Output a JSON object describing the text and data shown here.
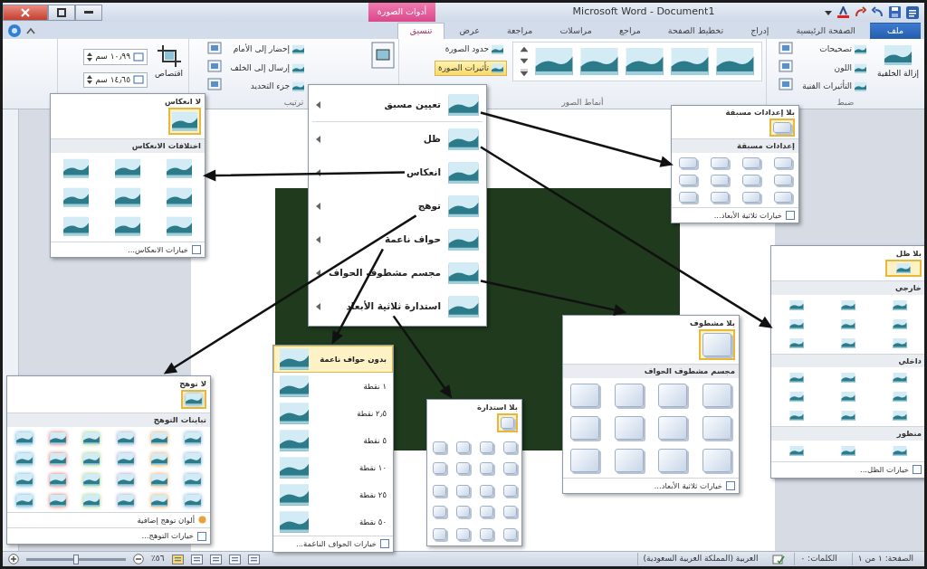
{
  "window": {
    "title": "Microsoft Word - Document1",
    "contextual_tab": "أدوات الصورة"
  },
  "tabs": [
    {
      "label": "ملف",
      "kind": "file",
      "selected": false
    },
    {
      "label": "الصفحة الرئيسية",
      "kind": "tab",
      "selected": false
    },
    {
      "label": "إدراج",
      "kind": "tab",
      "selected": false
    },
    {
      "label": "تخطيط الصفحة",
      "kind": "tab",
      "selected": false
    },
    {
      "label": "مراجع",
      "kind": "tab",
      "selected": false
    },
    {
      "label": "مراسلات",
      "kind": "tab",
      "selected": false
    },
    {
      "label": "مراجعة",
      "kind": "tab",
      "selected": false
    },
    {
      "label": "عرض",
      "kind": "tab",
      "selected": false
    },
    {
      "label": "تنسيق",
      "kind": "contextual",
      "selected": true
    }
  ],
  "ribbon": {
    "groups": [
      {
        "kind": "adjust",
        "label": "ضبط",
        "big_button": "إزالة الخلفية",
        "items": [
          {
            "label": "تصحيحات",
            "selected": false
          },
          {
            "label": "اللون",
            "selected": false
          },
          {
            "label": "التأثيرات الفنية",
            "selected": false
          }
        ]
      },
      {
        "kind": "styles",
        "label": "أنماط الصور",
        "items": [
          {
            "label": "حدود الصورة",
            "selected": false
          },
          {
            "label": "تأثيرات الصورة",
            "selected": true
          }
        ]
      },
      {
        "kind": "arrange",
        "label": "ترتيب",
        "items": [
          {
            "label": "إحضار إلى الأمام",
            "selected": false
          },
          {
            "label": "إرسال إلى الخلف",
            "selected": false
          },
          {
            "label": "جزء التحديد",
            "selected": false
          }
        ]
      },
      {
        "kind": "size",
        "big_button": "اقتصاص",
        "fields": [
          "١٠٫٩٩ سم",
          "١٤٫٦٥ سم"
        ]
      }
    ]
  },
  "effects_menu": [
    {
      "label": "تعيين مسبق"
    },
    {
      "label": "ظل"
    },
    {
      "label": "انعكاس"
    },
    {
      "label": "توهج"
    },
    {
      "label": "حواف ناعمة"
    },
    {
      "label": "مجسم مشطوف الحواف"
    },
    {
      "label": "استدارة ثلاثية الأبعاد"
    }
  ],
  "galleries": [
    {
      "kind": "preset",
      "none": {
        "label": "بلا إعدادات مسبقة",
        "selected": true
      },
      "sections": [
        "إعدادات مسبقة"
      ],
      "footer": "خيارات ثلاثية الأبعاد..."
    },
    {
      "kind": "shadow",
      "none": {
        "label": "بلا ظل",
        "selected": true
      },
      "sections": [
        "خارجي",
        "داخلي",
        "منظور"
      ],
      "footer": "خيارات الظل..."
    },
    {
      "kind": "reflection",
      "none": {
        "label": "لا انعكاس",
        "selected": true
      },
      "sections": [
        "اختلافات الانعكاس"
      ],
      "footer": "خيارات الانعكاس..."
    },
    {
      "kind": "glow",
      "none": {
        "label": "لا توهج",
        "selected": true
      },
      "sections": [
        "تباينات التوهج"
      ],
      "extra": "ألوان توهج إضافية",
      "footer": "خيارات التوهج..."
    },
    {
      "kind": "soft",
      "options": [
        {
          "label": "بدون حواف ناعمة",
          "selected": true
        },
        {
          "label": "١ نقطة",
          "selected": false
        },
        {
          "label": "٢٫٥ نقطة",
          "selected": false
        },
        {
          "label": "٥ نقطة",
          "selected": false
        },
        {
          "label": "١٠ نقطة",
          "selected": false
        },
        {
          "label": "٢٥ نقطة",
          "selected": false
        },
        {
          "label": "٥٠ نقطة",
          "selected": false
        }
      ],
      "footer": "خيارات الحواف الناعمة..."
    },
    {
      "kind": "bevel",
      "none": {
        "label": "بلا مشطوف",
        "selected": true
      },
      "sections": [
        "مجسم مشطوف الحواف"
      ],
      "footer": "خيارات ثلاثية الأبعاد..."
    },
    {
      "kind": "rotation",
      "none": {
        "label": "بلا استدارة",
        "selected": true
      }
    }
  ],
  "status_bar": {
    "page": "الصفحة: ١ من ١",
    "words": "الكلمات: ٠",
    "language": "العربية (المملكة العربية السعودية)",
    "zoom": "٥٦٪",
    "zoom_slider": {
      "level": 0.5
    }
  }
}
